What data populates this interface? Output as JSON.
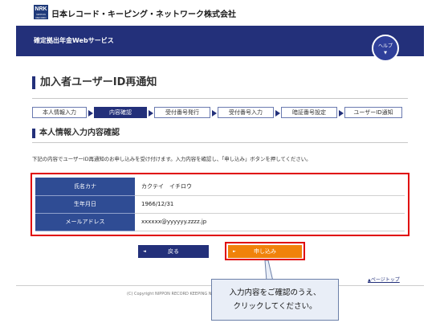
{
  "header": {
    "logo_text": "NRK",
    "logo_subtext": "NIPPON RECORD KEEPING NETWORK",
    "company_name": "日本レコード・キーピング・ネットワーク株式会社"
  },
  "navbar": {
    "service_name": "確定拠出年金Webサービス",
    "help_label": "ヘルプ",
    "help_caret": "▼"
  },
  "page": {
    "title": "加入者ユーザーID再通知"
  },
  "steps": [
    {
      "label": "本人情報入力",
      "active": false
    },
    {
      "label": "内容確認",
      "active": true
    },
    {
      "label": "受付番号発行",
      "active": false
    },
    {
      "label": "受付番号入力",
      "active": false
    },
    {
      "label": "暗証番号設定",
      "active": false
    },
    {
      "label": "ユーザーID通知",
      "active": false
    }
  ],
  "section": {
    "title": "本人情報入力内容確認",
    "intro": "下記の内容でユーザーID再通知のお申し込みを受け付けます。入力内容を確認し、「申し込み」ボタンを押してください。"
  },
  "info_rows": [
    {
      "key": "氏名カナ",
      "value": "カクテイ　イチロウ"
    },
    {
      "key": "生年月日",
      "value": "1966/12/31"
    },
    {
      "key": "メールアドレス",
      "value": "xxxxxx@yyyyyy.zzzz.jp"
    }
  ],
  "buttons": {
    "back_label": "戻る",
    "back_icon": "◄",
    "apply_label": "申し込み",
    "apply_icon": "►"
  },
  "footer": {
    "page_top_icon": "▲",
    "page_top_label": "ページトップ",
    "copyright": "(C) Copyright NIPPON RECORD KEEPING NE"
  },
  "callout": {
    "line1": "入力内容をご確認のうえ、",
    "line2": "クリックしてください。"
  },
  "colors": {
    "navy": "#23307a",
    "orange": "#f0820a",
    "highlight_red": "#e00000"
  }
}
